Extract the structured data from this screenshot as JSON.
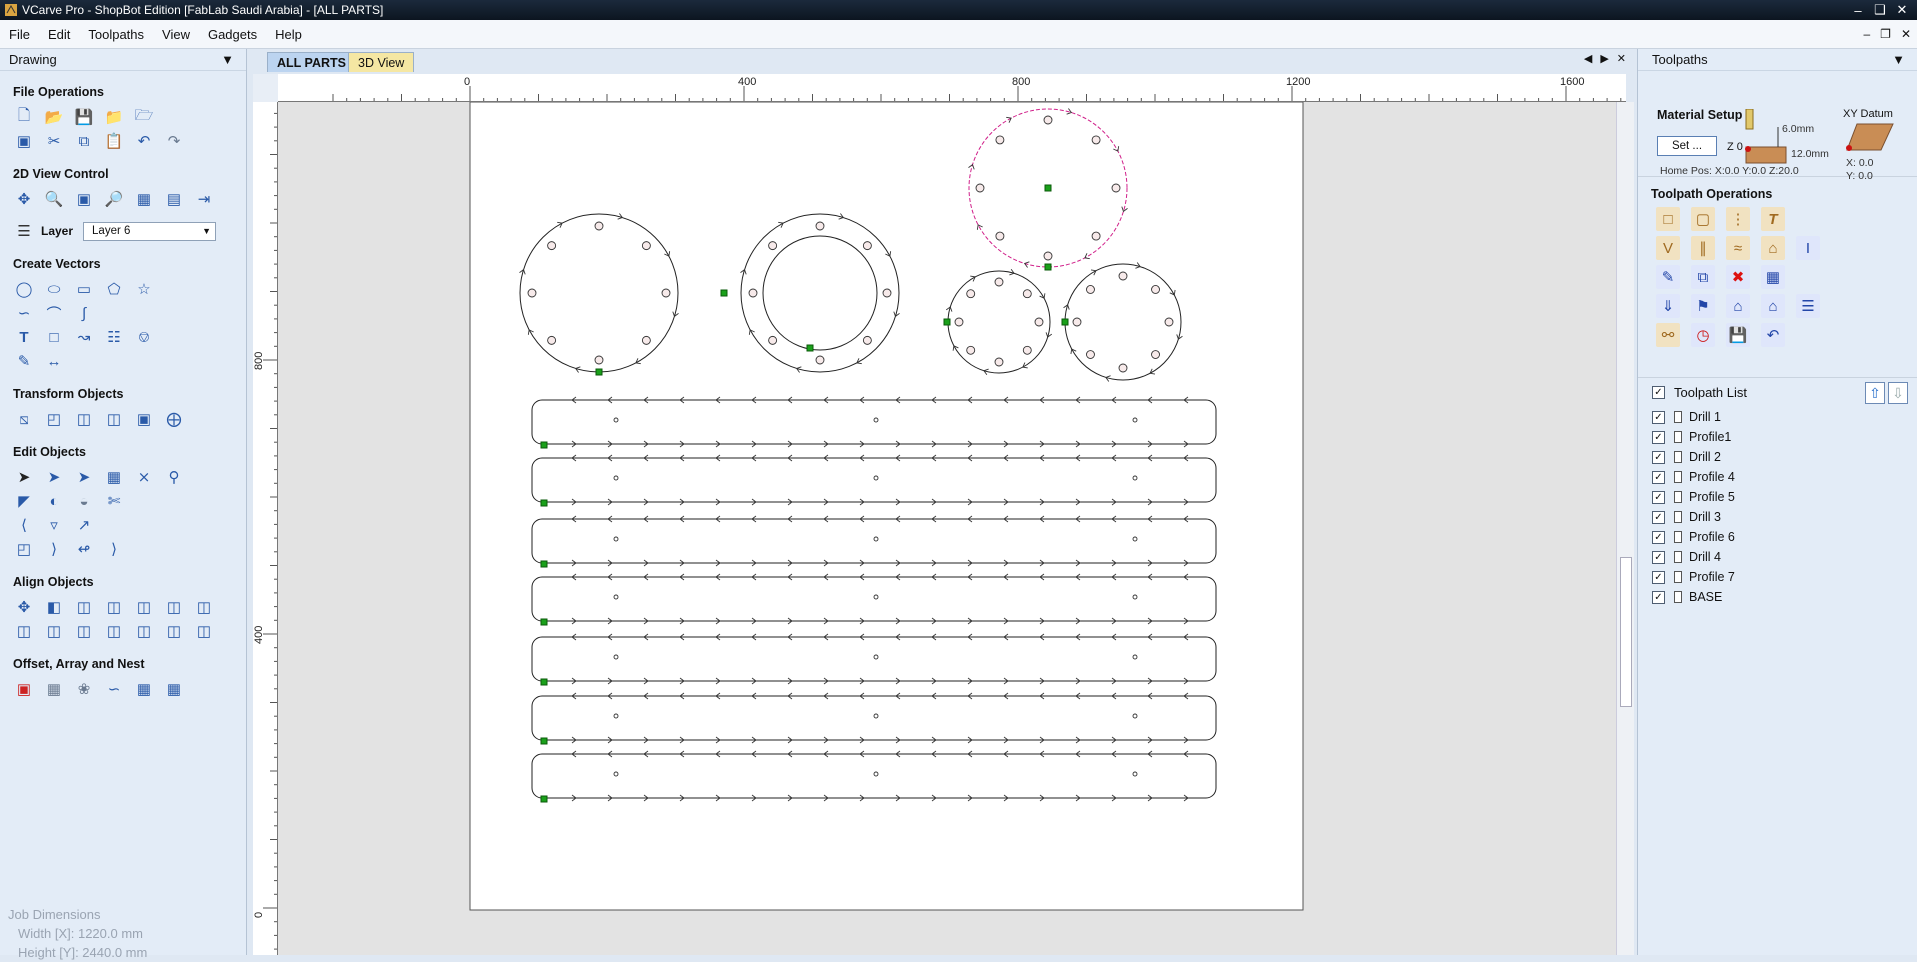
{
  "window": {
    "title": "VCarve Pro - ShopBot Edition [FabLab Saudi Arabia] - [ALL PARTS]"
  },
  "menu": [
    "File",
    "Edit",
    "Toolpaths",
    "View",
    "Gadgets",
    "Help"
  ],
  "left_panel": {
    "title": "Drawing",
    "sections": {
      "file_ops": "File Operations",
      "view_control": "2D View Control",
      "create_vectors": "Create Vectors",
      "transform": "Transform Objects",
      "edit": "Edit Objects",
      "align": "Align Objects",
      "offset": "Offset, Array and Nest"
    },
    "layer_label": "Layer",
    "layer_value": "Layer 6"
  },
  "job_dimensions": {
    "title": "Job Dimensions",
    "width": "Width  [X]: 1220.0 mm",
    "height": "Height [Y]: 2440.0 mm"
  },
  "tabs": {
    "all_parts": "ALL PARTS",
    "view3d": "3D View"
  },
  "ruler": {
    "top": [
      {
        "label": "0",
        "value": 0
      },
      {
        "label": "400",
        "value": 400
      },
      {
        "label": "800",
        "value": 800
      },
      {
        "label": "1200",
        "value": 1200
      },
      {
        "label": "1600",
        "value": 1600
      }
    ],
    "left": [
      {
        "label": "800",
        "value": 800
      },
      {
        "label": "400",
        "value": 400
      },
      {
        "label": "0",
        "value": 0
      }
    ]
  },
  "right_panel": {
    "title": "Toolpaths",
    "material_setup": "Material Setup",
    "set_button": "Set ...",
    "z0": "Z 0",
    "thickness_a": "6.0mm",
    "thickness_b": "12.0mm",
    "home_pos": "Home Pos:  X:0.0 Y:0.0 Z:20.0",
    "xy_datum": "XY Datum",
    "datum_x": "X: 0.0",
    "datum_y": "Y: 0.0",
    "toolpath_operations": "Toolpath Operations",
    "toolpath_list_title": "Toolpath List",
    "toolpaths": [
      "Drill 1",
      "Profile1",
      "Drill 2",
      "Profile 4",
      "Profile 5",
      "Drill 3",
      "Profile 6",
      "Drill 4",
      "Profile 7",
      "BASE"
    ]
  },
  "colors": {
    "vector": "#222222",
    "selected": "#d0208a",
    "start_node": "#1aa01a",
    "panel": "#e3ecf7"
  }
}
